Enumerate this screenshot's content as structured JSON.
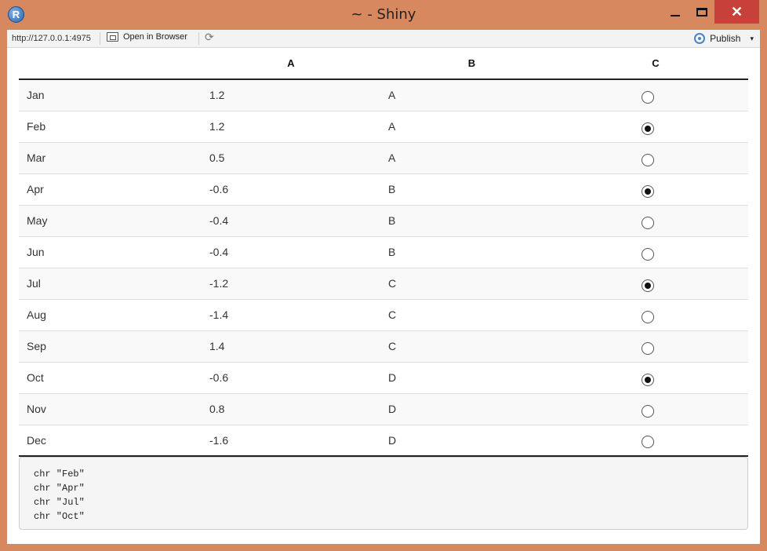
{
  "window": {
    "title": "~ - Shiny",
    "icon_letter": "R",
    "close_glyph": "✕"
  },
  "toolbar": {
    "url": "http://127.0.0.1:4975",
    "open_label": "Open in Browser",
    "publish_label": "Publish",
    "refresh_glyph": "⟳",
    "caret_glyph": "▾"
  },
  "table": {
    "headers": [
      "",
      "A",
      "B",
      "C"
    ],
    "rows": [
      {
        "month": "Jan",
        "a": "1.2",
        "b": "A",
        "c_checked": false
      },
      {
        "month": "Feb",
        "a": "1.2",
        "b": "A",
        "c_checked": true
      },
      {
        "month": "Mar",
        "a": "0.5",
        "b": "A",
        "c_checked": false
      },
      {
        "month": "Apr",
        "a": "-0.6",
        "b": "B",
        "c_checked": true
      },
      {
        "month": "May",
        "a": "-0.4",
        "b": "B",
        "c_checked": false
      },
      {
        "month": "Jun",
        "a": "-0.4",
        "b": "B",
        "c_checked": false
      },
      {
        "month": "Jul",
        "a": "-1.2",
        "b": "C",
        "c_checked": true
      },
      {
        "month": "Aug",
        "a": "-1.4",
        "b": "C",
        "c_checked": false
      },
      {
        "month": "Sep",
        "a": "1.4",
        "b": "C",
        "c_checked": false
      },
      {
        "month": "Oct",
        "a": "-0.6",
        "b": "D",
        "c_checked": true
      },
      {
        "month": "Nov",
        "a": "0.8",
        "b": "D",
        "c_checked": false
      },
      {
        "month": "Dec",
        "a": "-1.6",
        "b": "D",
        "c_checked": false
      }
    ]
  },
  "output": {
    "lines": [
      "chr \"Feb\"",
      "chr \"Apr\"",
      "chr \"Jul\"",
      "chr \"Oct\""
    ]
  },
  "colors": {
    "window_frame": "#d8885f",
    "close_button": "#c7413a"
  }
}
